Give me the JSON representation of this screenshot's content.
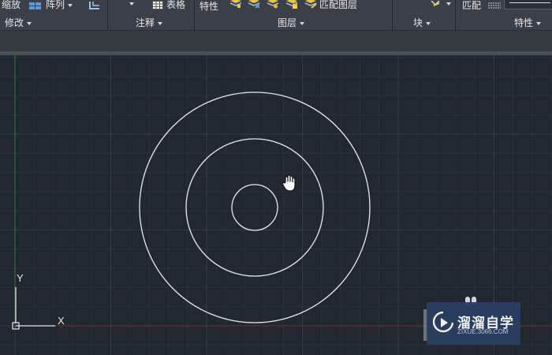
{
  "ribbon": {
    "modify": {
      "scale_label": "缩放",
      "array_label": "阵列",
      "panel_title": "修改"
    },
    "annotation": {
      "table_label": "表格",
      "panel_title": "注释"
    },
    "layers": {
      "properties_label": "特性",
      "match_layer_label": "匹配图层",
      "panel_title": "图层"
    },
    "block": {
      "panel_title": "块"
    },
    "properties": {
      "match_label": "匹配",
      "panel_title": "特性"
    }
  },
  "canvas": {
    "ucs": {
      "y_label": "Y",
      "x_label": "X"
    },
    "circles_count": 3,
    "colors": {
      "background": "#212830",
      "grid_minor": "#283039",
      "grid_major": "#323b46",
      "y_axis": "#2f7a3a",
      "x_axis": "#7a2a2a",
      "circle": "#e8e8e8"
    }
  },
  "cursor": {
    "icon": "pan-hand-icon"
  },
  "watermark": {
    "name": "溜溜自学",
    "url": "ZIXUE.3066.COM",
    "colors": {
      "bg": "#2a3f63"
    }
  }
}
